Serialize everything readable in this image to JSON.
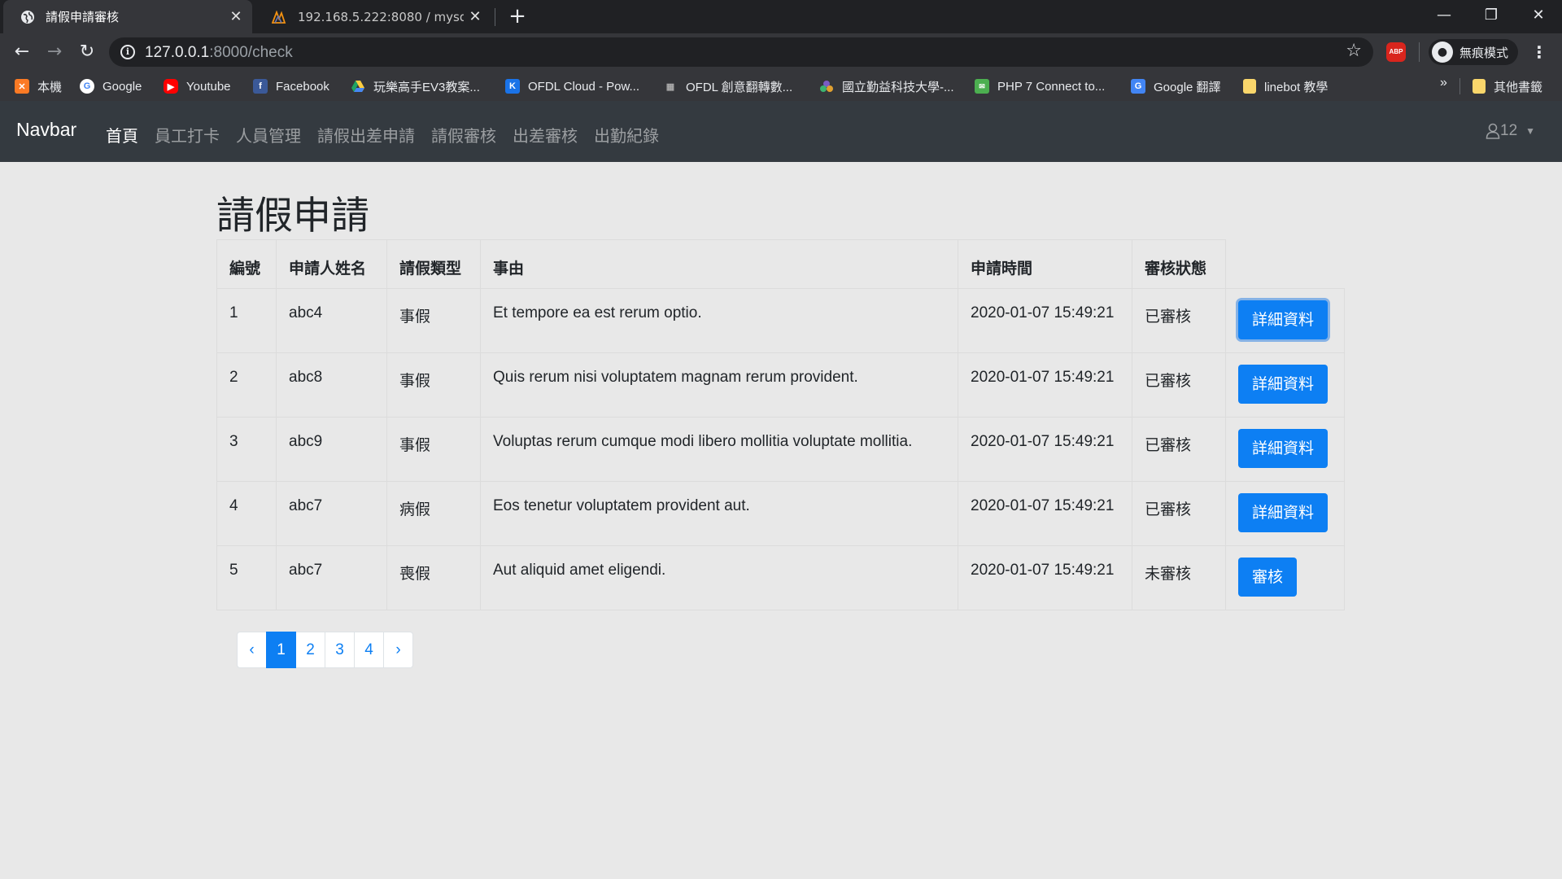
{
  "browser": {
    "tabs": [
      {
        "title": "請假申請審核",
        "close": "✕"
      },
      {
        "title": "192.168.5.222:8080 / mysql / fi",
        "close": "✕"
      }
    ],
    "new_tab": "+",
    "window_controls": {
      "minimize": "—",
      "restore": "❐",
      "close": "✕"
    },
    "url_host": "127.0.0.1",
    "url_rest": ":8000/check",
    "abp_label": "ABP",
    "incognito_label": "無痕模式",
    "bookmarks": [
      {
        "label": "本機",
        "icon": "xampp-icon",
        "color": "#fb7a24"
      },
      {
        "label": "Google",
        "icon": "google-icon",
        "color": "#ffffff"
      },
      {
        "label": "Youtube",
        "icon": "youtube-icon",
        "color": "#ff0000"
      },
      {
        "label": "Facebook",
        "icon": "facebook-icon",
        "color": "#3b5998"
      },
      {
        "label": "玩樂高手EV3教案...",
        "icon": "drive-icon",
        "color": "#1fa463"
      },
      {
        "label": "OFDL Cloud - Pow...",
        "icon": "k-icon",
        "color": "#1a73e8"
      },
      {
        "label": "OFDL 創意翻轉數...",
        "icon": "site-icon",
        "color": "#888888"
      },
      {
        "label": "國立勤益科技大學-...",
        "icon": "school-icon",
        "color": "#7b5cc4"
      },
      {
        "label": "PHP 7 Connect to...",
        "icon": "php-icon",
        "color": "#4caf50"
      },
      {
        "label": "Google 翻譯",
        "icon": "translate-icon",
        "color": "#4285f4"
      },
      {
        "label": "linebot 教學",
        "icon": "folder-icon",
        "color": "#f9d66b"
      }
    ],
    "bookmarks_more": "»",
    "other_bookmarks": "其他書籤"
  },
  "navbar": {
    "brand": "Navbar",
    "links": [
      {
        "label": "首頁",
        "active": true
      },
      {
        "label": "員工打卡",
        "active": false
      },
      {
        "label": "人員管理",
        "active": false
      },
      {
        "label": "請假出差申請",
        "active": false
      },
      {
        "label": "請假審核",
        "active": false
      },
      {
        "label": "出差審核",
        "active": false
      },
      {
        "label": "出勤紀錄",
        "active": false
      }
    ],
    "user": "12"
  },
  "main": {
    "title": "請假申請",
    "columns": [
      "編號",
      "申請人姓名",
      "請假類型",
      "事由",
      "申請時間",
      "審核狀態",
      ""
    ],
    "rows": [
      {
        "id": "1",
        "name": "abc4",
        "type": "事假",
        "reason": "Et tempore ea est rerum optio.",
        "time": "2020-01-07 15:49:21",
        "status": "已審核",
        "action": "詳細資料"
      },
      {
        "id": "2",
        "name": "abc8",
        "type": "事假",
        "reason": "Quis rerum nisi voluptatem magnam rerum provident.",
        "time": "2020-01-07 15:49:21",
        "status": "已審核",
        "action": "詳細資料"
      },
      {
        "id": "3",
        "name": "abc9",
        "type": "事假",
        "reason": "Voluptas rerum cumque modi libero mollitia voluptate mollitia.",
        "time": "2020-01-07 15:49:21",
        "status": "已審核",
        "action": "詳細資料"
      },
      {
        "id": "4",
        "name": "abc7",
        "type": "病假",
        "reason": "Eos tenetur voluptatem provident aut.",
        "time": "2020-01-07 15:49:21",
        "status": "已審核",
        "action": "詳細資料"
      },
      {
        "id": "5",
        "name": "abc7",
        "type": "喪假",
        "reason": "Aut aliquid amet eligendi.",
        "time": "2020-01-07 15:49:21",
        "status": "未審核",
        "action": "審核"
      }
    ],
    "pagination": {
      "prev": "‹",
      "pages": [
        "1",
        "2",
        "3",
        "4"
      ],
      "current": "1",
      "next": "›"
    }
  },
  "colors": {
    "accent": "#0d7ff3",
    "navbar_bg": "#343a40",
    "page_bg": "#e8e8e8"
  }
}
